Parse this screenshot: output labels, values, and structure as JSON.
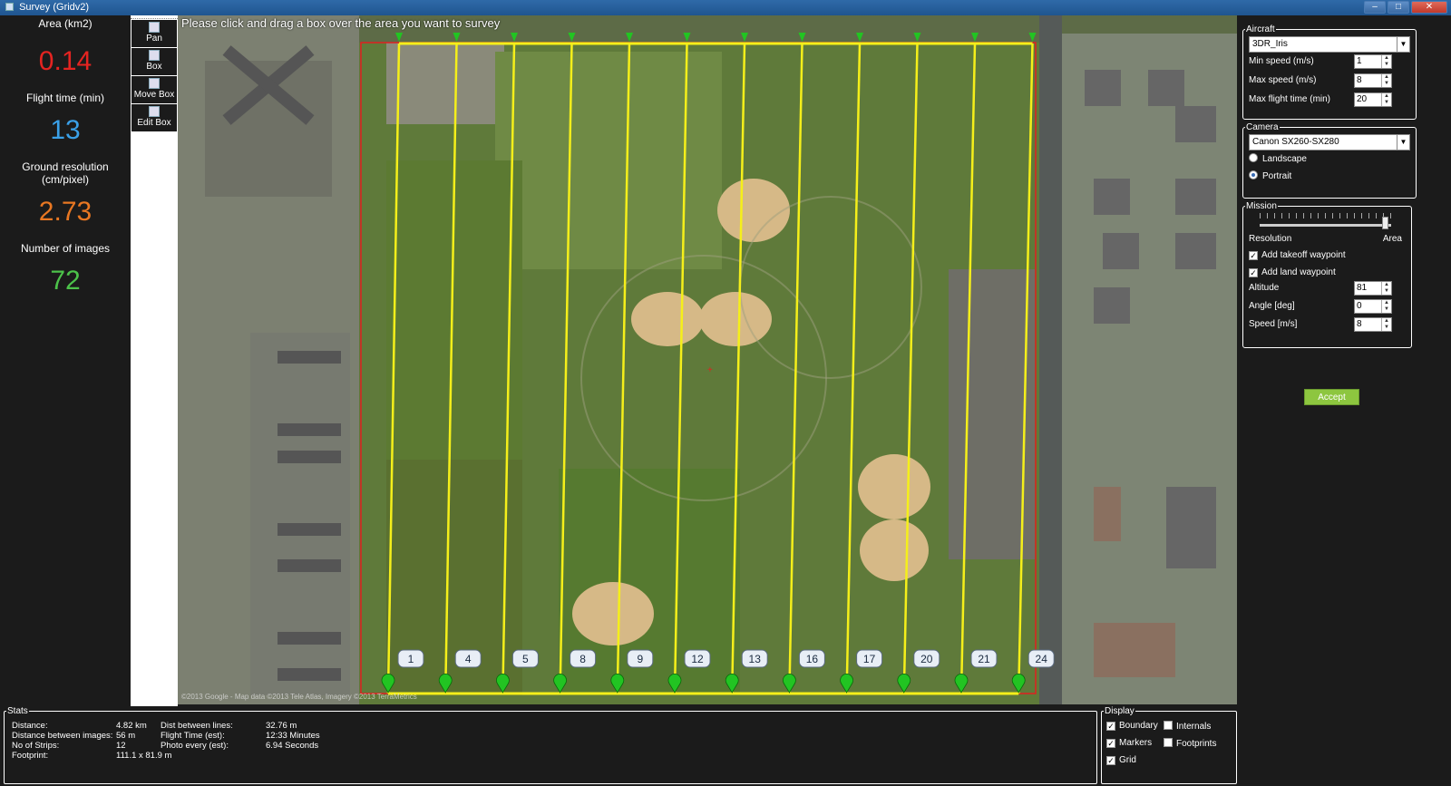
{
  "window": {
    "title": "Survey (Gridv2)"
  },
  "stats_left": [
    {
      "label": "Area (km2)",
      "value": "0.14",
      "color": "#e52421"
    },
    {
      "label": "Flight time (min)",
      "value": "13",
      "color": "#3aa0e8"
    },
    {
      "label": "Ground resolution (cm/pixel)",
      "value": "2.73",
      "color": "#e87722"
    },
    {
      "label": "Number of images",
      "value": "72",
      "color": "#4cc24a"
    }
  ],
  "tools": [
    {
      "label": "Pan",
      "icon": "pan-icon"
    },
    {
      "label": "Box",
      "icon": "box-icon"
    },
    {
      "label": "Move Box",
      "icon": "move-box-icon"
    },
    {
      "label": "Edit Box",
      "icon": "edit-box-icon"
    }
  ],
  "map": {
    "instruction": "Please click and drag a box over the area you want to survey",
    "copyright": "©2013 Google - Map data ©2013 Tele Atlas, Imagery ©2013 TerraMetrics",
    "marker_labels": [
      "1",
      "4",
      "5",
      "8",
      "9",
      "12",
      "13",
      "16",
      "17",
      "20",
      "21",
      "24"
    ],
    "line_color": "#f5ef1a",
    "boundary_color": "#e02020"
  },
  "aircraft": {
    "legend": "Aircraft",
    "model": "3DR_Iris",
    "min_speed_label": "Min speed (m/s)",
    "min_speed": "1",
    "max_speed_label": "Max speed (m/s)",
    "max_speed": "8",
    "max_flight_label": "Max flight time (min)",
    "max_flight": "20"
  },
  "camera": {
    "legend": "Camera",
    "model": "Canon SX260-SX280",
    "landscape": "Landscape",
    "portrait": "Portrait"
  },
  "mission": {
    "legend": "Mission",
    "slider_left": "Resolution",
    "slider_right": "Area",
    "slider_fraction": 0.93,
    "takeoff": "Add takeoff waypoint",
    "land": "Add land waypoint",
    "altitude_label": "Altitude",
    "altitude": "81",
    "angle_label": "Angle [deg]",
    "angle": "0",
    "speed_label": "Speed [m/s]",
    "speed": "8"
  },
  "accept_label": "Accept",
  "stats": {
    "legend": "Stats",
    "distance_label": "Distance:",
    "distance": "4.82 km",
    "dist_images_label": "Distance between images:",
    "dist_images": "56 m",
    "strips_label": "No of Strips:",
    "strips": "12",
    "footprint_label": "Footprint:",
    "footprint": "111.1 x 81.9 m",
    "dist_lines_label": "Dist between lines:",
    "dist_lines": "32.76 m",
    "flight_time_label": "Flight Time (est):",
    "flight_time": "12:33 Minutes",
    "photo_every_label": "Photo every (est):",
    "photo_every": "6.94 Seconds"
  },
  "display": {
    "legend": "Display",
    "boundary": "Boundary",
    "internals": "Internals",
    "markers": "Markers",
    "footprints": "Footprints",
    "grid": "Grid"
  }
}
